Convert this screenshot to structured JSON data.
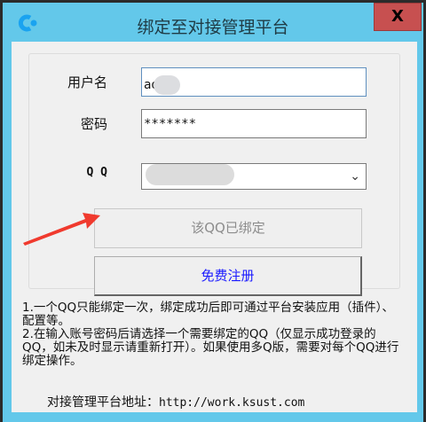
{
  "window": {
    "title": "绑定至对接管理平台",
    "close_label": "X"
  },
  "form": {
    "username_label": "用户名",
    "username_value": "ad",
    "password_label": "密码",
    "password_value": "*******",
    "qq_label": "Q Q"
  },
  "buttons": {
    "bound": "该QQ已绑定",
    "register": "免费注册"
  },
  "notes": {
    "line1": "1.一个QQ只能绑定一次，绑定成功后即可通过平台安装应用（插件）、配置等。",
    "line2": "2.在输入账号密码后请选择一个需要绑定的QQ（仅显示成功登录的QQ，如未及时显示请重新打开）。如果使用多Q版，需要对每个QQ进行绑定操作。"
  },
  "address": {
    "label": "对接管理平台地址：",
    "url": "http://work.ksust.com"
  },
  "colors": {
    "titlebar": "#63c8ea",
    "close": "#c75050",
    "register_text": "#1a1aff",
    "arrow": "#f03a2e"
  }
}
